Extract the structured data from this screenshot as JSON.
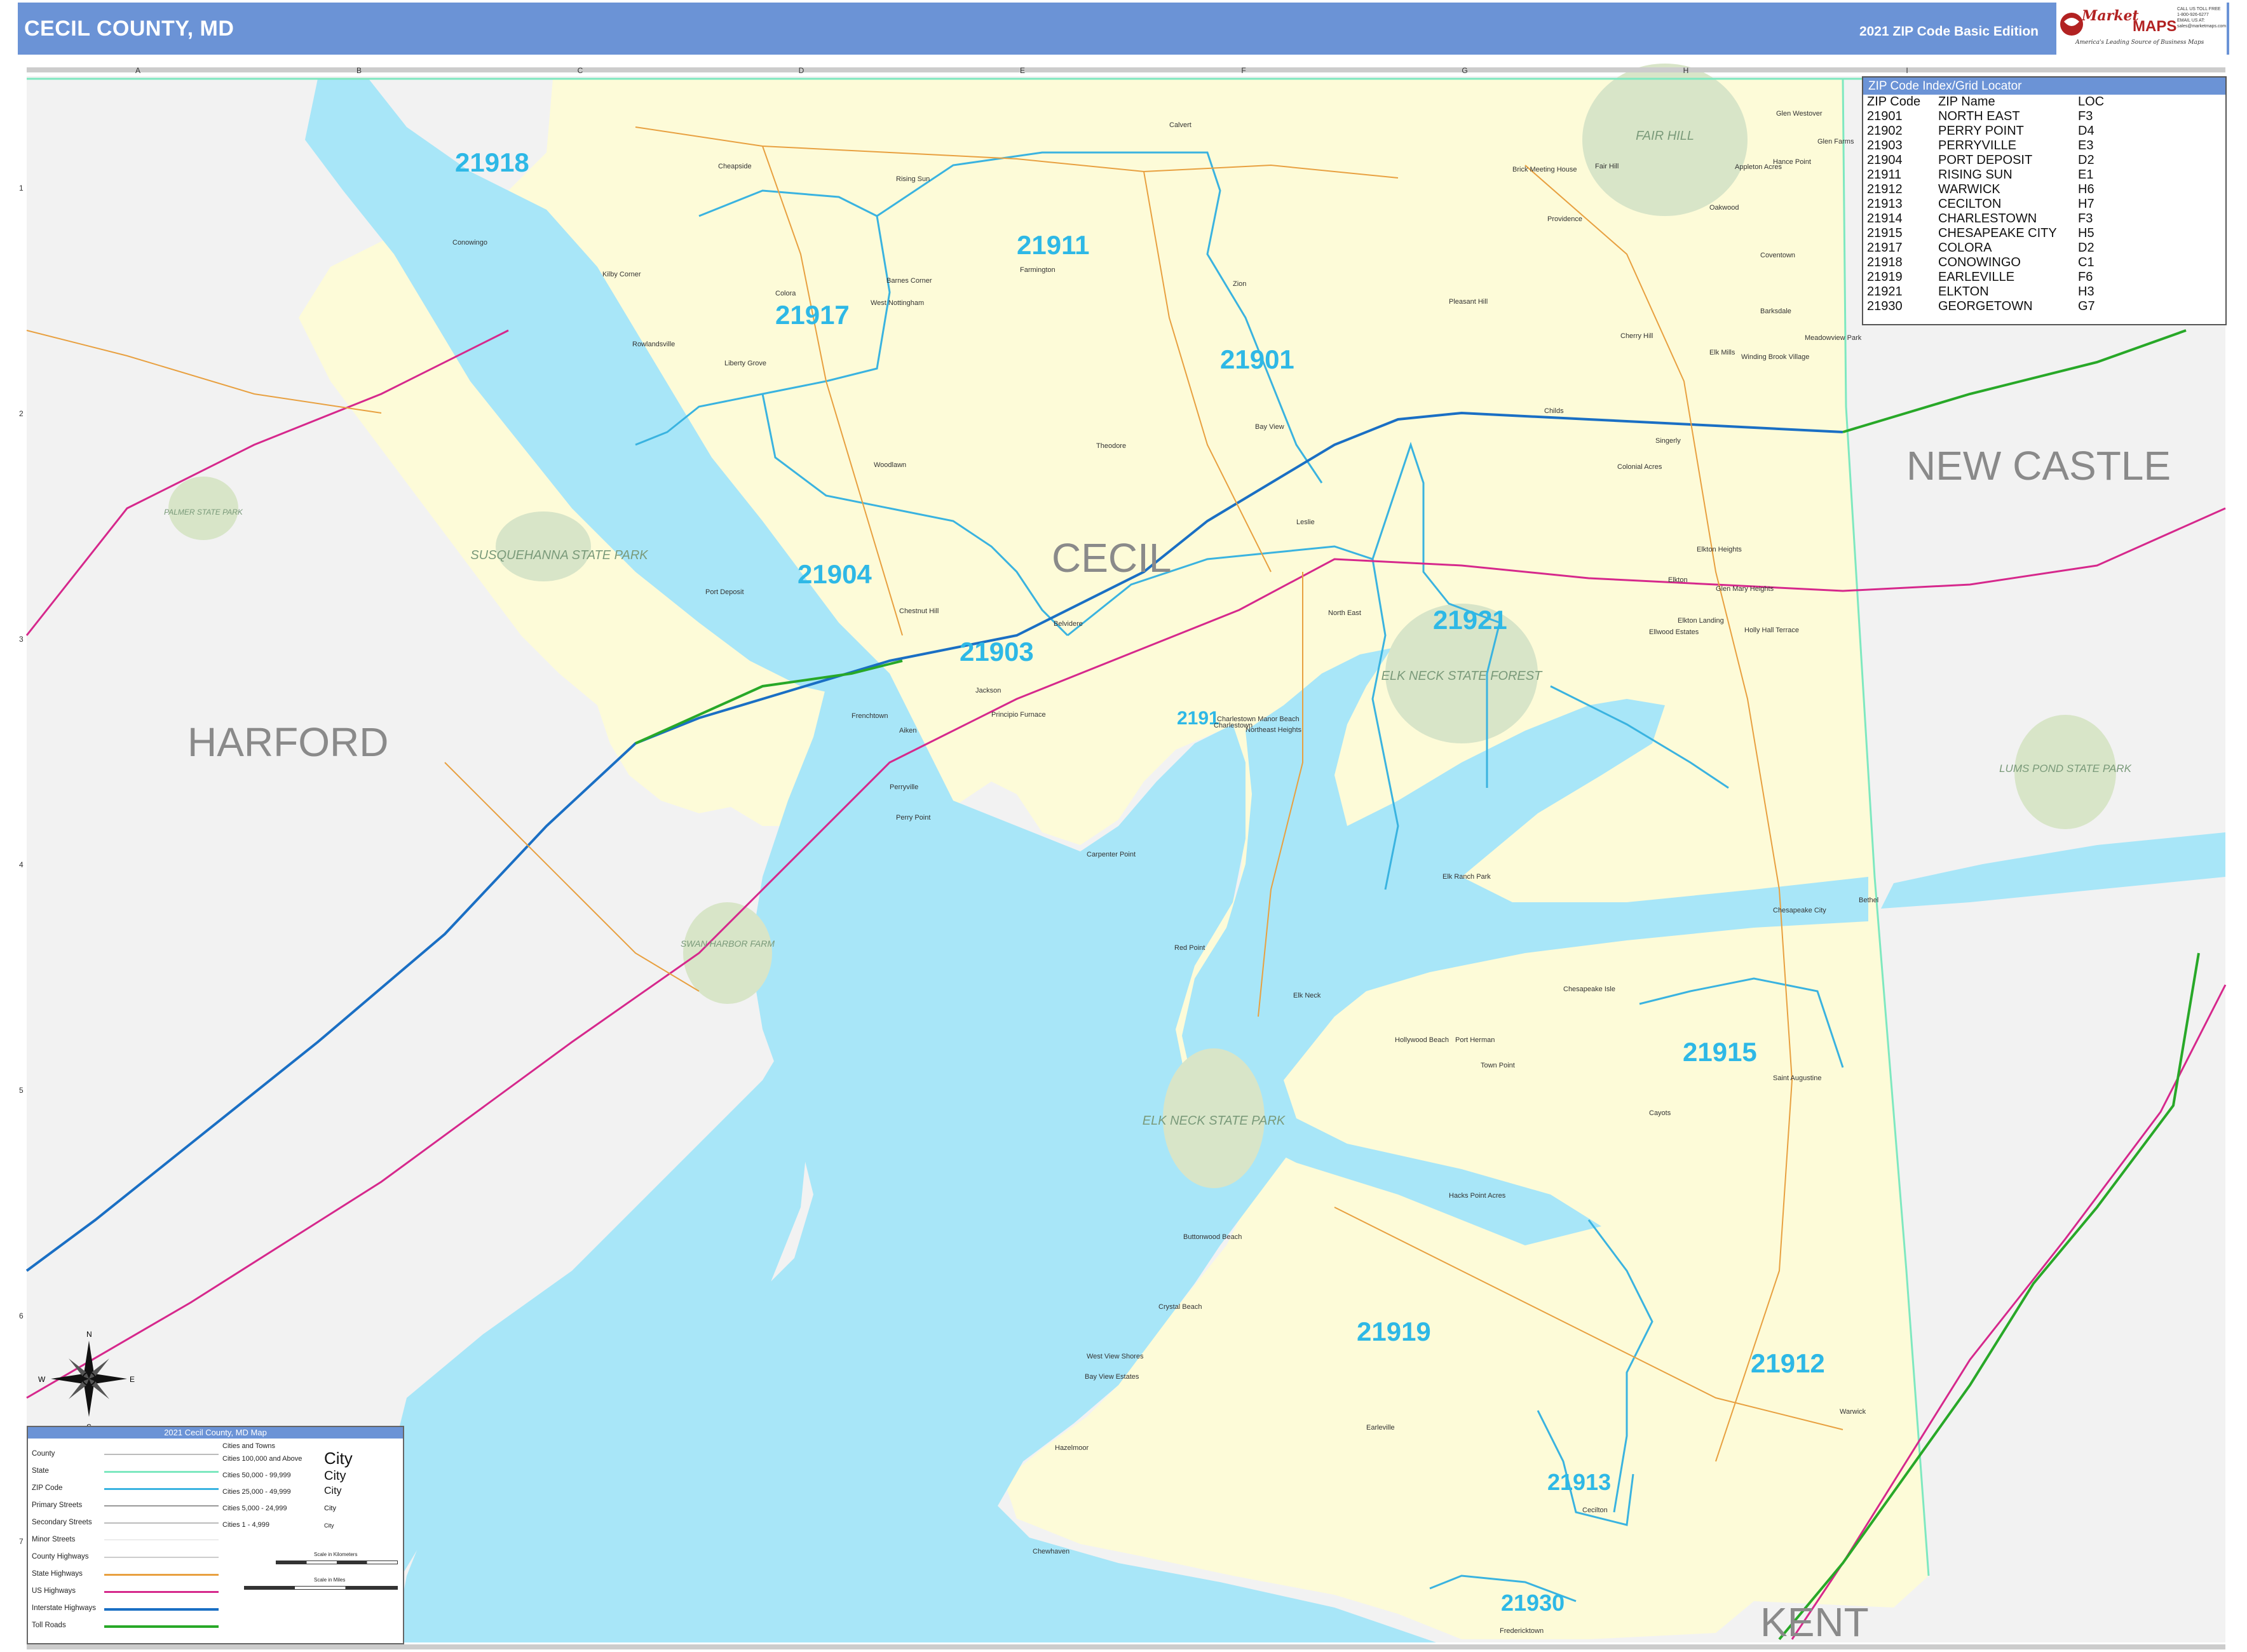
{
  "header": {
    "title": "CECIL COUNTY, MD",
    "edition": "2021 ZIP Code Basic Edition",
    "logo_market": "Market",
    "logo_maps": "MAPS",
    "logo_tagline": "America's Leading Source of Business Maps",
    "logo_order": "CALL US TOLL FREE 1-800-926-6277 EMAIL US AT: sales@marketmaps.com"
  },
  "grid": {
    "columns": [
      "A",
      "B",
      "C",
      "D",
      "E",
      "F",
      "G",
      "H",
      "I"
    ],
    "rows": [
      "1",
      "2",
      "3",
      "4",
      "5",
      "6",
      "7"
    ]
  },
  "colors": {
    "water": "#a8e6f8",
    "cecil_land": "#fdfbd8",
    "other_land": "#f2f2f2",
    "park": "#d8e5c8",
    "zip_boundary": "#3ab3e0",
    "zip_label": "#2eb8e6",
    "interstate": "#1a6fc4",
    "us_highway": "#d6288c",
    "toll_road": "#28a828",
    "state_highway": "#e8a040",
    "state_line": "#7ee8c0",
    "county_label": "#8a8a8a"
  },
  "county_labels": [
    "HARFORD",
    "CECIL",
    "NEW CASTLE",
    "KENT"
  ],
  "park_labels": [
    "FAIR HILL",
    "SUSQUEHANNA STATE PARK",
    "ELK NECK STATE FOREST",
    "ELK NECK STATE PARK",
    "SWAN HARBOR FARM",
    "PALMER STATE PARK",
    "LUMS POND STATE PARK"
  ],
  "zip_labels": [
    "21918",
    "21911",
    "21917",
    "21901",
    "21904",
    "21903",
    "21921",
    "2191",
    "21915",
    "21919",
    "21912",
    "21913",
    "21930"
  ],
  "towns": [
    "Conowingo",
    "Colora",
    "Rising Sun",
    "Calvert",
    "Fair Hill",
    "Farmington",
    "Zion",
    "Port Deposit",
    "Perryville",
    "Charlestown",
    "North East",
    "Elkton",
    "Chesapeake City",
    "Earleville",
    "Cecilton",
    "Warwick",
    "Fredericktown",
    "Bay View",
    "Principio Furnace",
    "Red Point",
    "Elk Neck",
    "Town Point",
    "Cayots",
    "Saint Augustine",
    "Chesapeake Isle",
    "Elk Mills",
    "Providence",
    "Cherry Hill",
    "Leslie",
    "Theodore",
    "Woodlawn",
    "Belvidere",
    "Jackson",
    "Aiken",
    "Frenchtown",
    "Singerly",
    "Childs",
    "Glen Farms",
    "Appleton Acres",
    "Hollywood Beach",
    "Port Herman",
    "Crystal Beach",
    "Buttonwood Beach",
    "West View Shores",
    "Bay View Estates",
    "Hacks Point Acres",
    "Elk Ranch Park",
    "Charlestown Manor Beach",
    "Northeast Heights",
    "Carpenter Point",
    "Perry Point",
    "Chestnut Hill",
    "Bethel",
    "Glen Westover",
    "Hance Point",
    "Oakwood",
    "Elkton Heights",
    "Holly Hall Terrace",
    "Ellwood Estates",
    "Cheapside",
    "Liberty Grove",
    "Rowlandsville",
    "Kilby Corner",
    "Barnes Corner",
    "West Nottingham",
    "Pleasant Hill",
    "Brick Meeting House",
    "Colonial Acres",
    "Meadowview Park",
    "Coventown",
    "Barksdale",
    "Winding Brook Village",
    "Glen Mary Heights",
    "Elkton Landing",
    "Hazelmoor",
    "Chewhaven"
  ],
  "zip_index": {
    "title": "ZIP Code Index/Grid Locator",
    "headers": [
      "ZIP Code",
      "ZIP Name",
      "LOC"
    ],
    "rows": [
      [
        "21901",
        "NORTH EAST",
        "F3"
      ],
      [
        "21902",
        "PERRY POINT",
        "D4"
      ],
      [
        "21903",
        "PERRYVILLE",
        "E3"
      ],
      [
        "21904",
        "PORT DEPOSIT",
        "D2"
      ],
      [
        "21911",
        "RISING SUN",
        "E1"
      ],
      [
        "21912",
        "WARWICK",
        "H6"
      ],
      [
        "21913",
        "CECILTON",
        "H7"
      ],
      [
        "21914",
        "CHARLESTOWN",
        "F3"
      ],
      [
        "21915",
        "CHESAPEAKE CITY",
        "H5"
      ],
      [
        "21917",
        "COLORA",
        "D2"
      ],
      [
        "21918",
        "CONOWINGO",
        "C1"
      ],
      [
        "21919",
        "EARLEVILLE",
        "F6"
      ],
      [
        "21921",
        "ELKTON",
        "H3"
      ],
      [
        "21930",
        "GEORGETOWN",
        "G7"
      ]
    ]
  },
  "legend": {
    "title": "2021 Cecil County, MD Map",
    "items": [
      "County",
      "State",
      "ZIP Code",
      "Primary Streets",
      "Secondary Streets",
      "Minor Streets",
      "County Highways",
      "State Highways",
      "US Highways",
      "Interstate Highways",
      "Toll Roads"
    ],
    "cities_header": "Cities and Towns",
    "cities": [
      "Cities 100,000 and Above",
      "Cities 50,000 - 99,999",
      "Cities 25,000 - 49,999",
      "Cities 5,000 - 24,999",
      "Cities 1 - 4,999"
    ],
    "city_samples": [
      "City",
      "City",
      "City",
      "City",
      "City"
    ],
    "scale_km": "Scale in Kilometers",
    "scale_mi": "Scale in Miles"
  },
  "compass": [
    "N",
    "S",
    "E",
    "W"
  ]
}
